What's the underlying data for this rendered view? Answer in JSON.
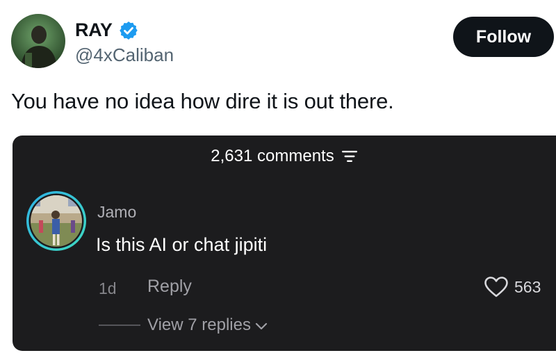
{
  "tweet": {
    "author": {
      "display_name": "RAY",
      "handle": "@4xCaliban",
      "verified": true
    },
    "follow_label": "Follow",
    "text": "You have no idea how dire it is out there."
  },
  "embedded_comments": {
    "count_label": "2,631 comments",
    "comment": {
      "author": "Jamo",
      "text": "Is this AI or chat jipiti",
      "age": "1d",
      "reply_label": "Reply",
      "likes": "563",
      "view_replies_label": "View 7 replies"
    }
  },
  "icons": {
    "verified": "verified-badge-icon",
    "sort": "sort-filter-icon",
    "like": "heart-icon",
    "expand": "chevron-down-icon"
  },
  "colors": {
    "follow_bg": "#0f1419",
    "verified_blue": "#1d9bf0",
    "embed_bg": "#1c1c1e",
    "avatar_ring": "#39c6d7"
  }
}
